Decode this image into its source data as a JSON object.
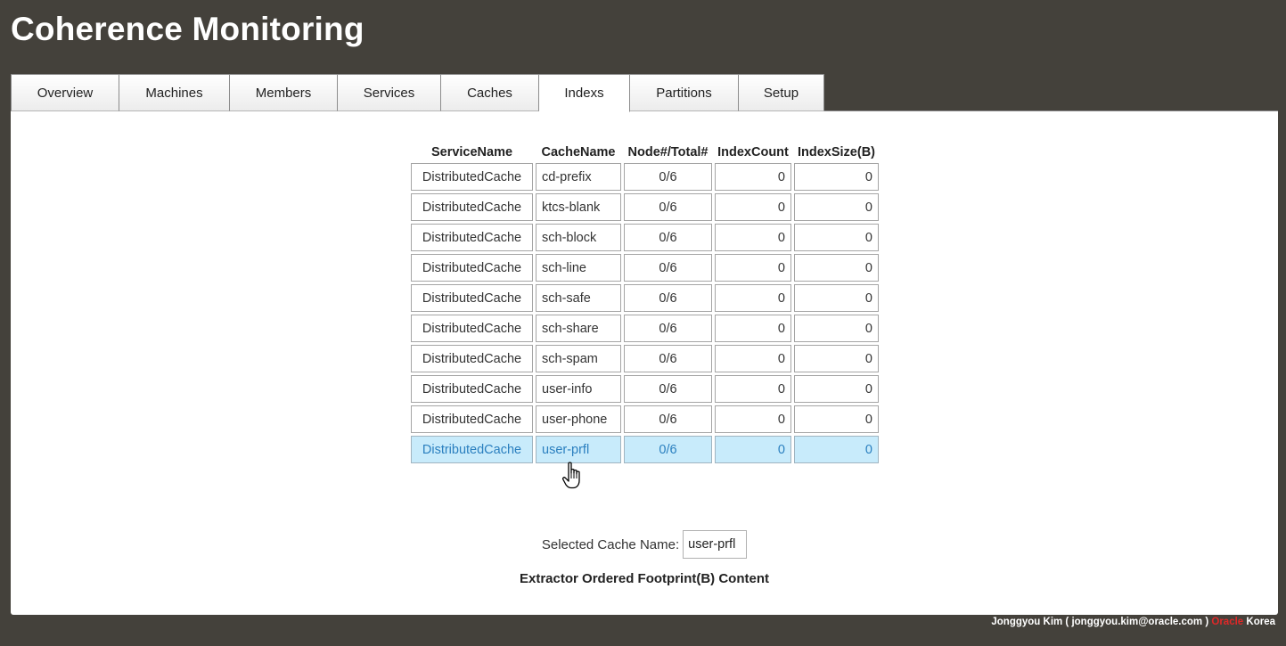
{
  "app": {
    "title": "Coherence Monitoring"
  },
  "tabs": [
    {
      "label": "Overview",
      "active": false
    },
    {
      "label": "Machines",
      "active": false
    },
    {
      "label": "Members",
      "active": false
    },
    {
      "label": "Services",
      "active": false
    },
    {
      "label": "Caches",
      "active": false
    },
    {
      "label": "Indexs",
      "active": true
    },
    {
      "label": "Partitions",
      "active": false
    },
    {
      "label": "Setup",
      "active": false
    }
  ],
  "table": {
    "headers": {
      "service": "ServiceName",
      "cache": "CacheName",
      "node": "Node#/Total#",
      "count": "IndexCount",
      "size": "IndexSize(B)"
    },
    "rows": [
      {
        "service": "DistributedCache",
        "cache": "cd-prefix",
        "node": "0/6",
        "count": "0",
        "size": "0",
        "selected": false
      },
      {
        "service": "DistributedCache",
        "cache": "ktcs-blank",
        "node": "0/6",
        "count": "0",
        "size": "0",
        "selected": false
      },
      {
        "service": "DistributedCache",
        "cache": "sch-block",
        "node": "0/6",
        "count": "0",
        "size": "0",
        "selected": false
      },
      {
        "service": "DistributedCache",
        "cache": "sch-line",
        "node": "0/6",
        "count": "0",
        "size": "0",
        "selected": false
      },
      {
        "service": "DistributedCache",
        "cache": "sch-safe",
        "node": "0/6",
        "count": "0",
        "size": "0",
        "selected": false
      },
      {
        "service": "DistributedCache",
        "cache": "sch-share",
        "node": "0/6",
        "count": "0",
        "size": "0",
        "selected": false
      },
      {
        "service": "DistributedCache",
        "cache": "sch-spam",
        "node": "0/6",
        "count": "0",
        "size": "0",
        "selected": false
      },
      {
        "service": "DistributedCache",
        "cache": "user-info",
        "node": "0/6",
        "count": "0",
        "size": "0",
        "selected": false
      },
      {
        "service": "DistributedCache",
        "cache": "user-phone",
        "node": "0/6",
        "count": "0",
        "size": "0",
        "selected": false
      },
      {
        "service": "DistributedCache",
        "cache": "user-prfl",
        "node": "0/6",
        "count": "0",
        "size": "0",
        "selected": true
      }
    ]
  },
  "selection": {
    "label": "Selected Cache Name:",
    "value": "user-prfl"
  },
  "extractor": {
    "heading": "Extractor Ordered Footprint(B) Content"
  },
  "footer": {
    "author": "Jonggyou Kim ( jonggyou.kim@oracle.com )",
    "brand": "Oracle",
    "region": "Korea"
  },
  "colors": {
    "page_background": "#44413b",
    "panel_background": "#ffffff",
    "selected_row_background": "#c8ebfb",
    "selected_row_text": "#2a7fbf",
    "brand_red": "#e02828"
  },
  "icons": {
    "cursor": "hand-pointer-icon"
  }
}
